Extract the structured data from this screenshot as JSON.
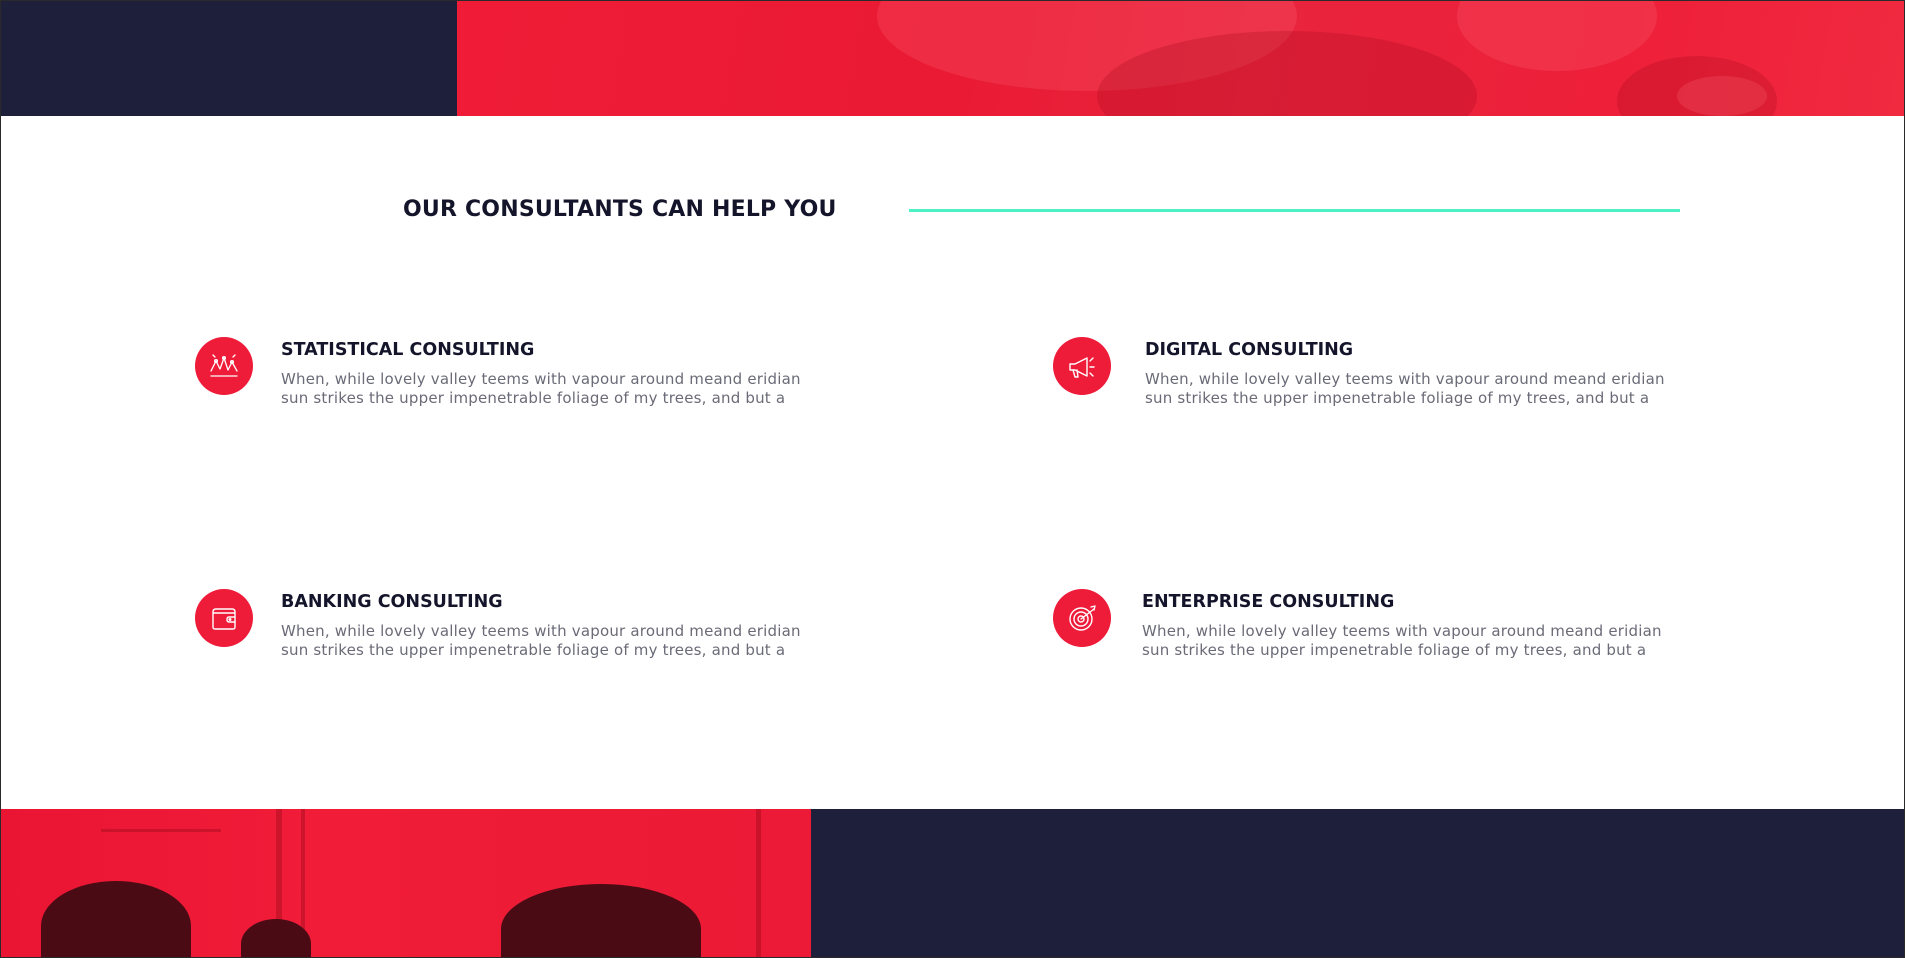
{
  "colors": {
    "navy": "#1e1f3b",
    "accent_red": "#ee1b39",
    "mint_rule": "#4cf2c3",
    "heading_text": "#14152b",
    "body_text": "#6b6b78"
  },
  "section": {
    "title": "OUR CONSULTANTS CAN HELP YOU"
  },
  "services": [
    {
      "icon": "chart-icon",
      "title": "STATISTICAL CONSULTING",
      "description": "When, while lovely valley teems with vapour around meand eridian sun strikes the upper impenetrable foliage of my trees, and but a"
    },
    {
      "icon": "megaphone-icon",
      "title": "DIGITAL CONSULTING",
      "description": "When, while lovely valley teems with vapour around meand eridian sun strikes the upper impenetrable foliage of my trees, and but a"
    },
    {
      "icon": "wallet-icon",
      "title": "BANKING CONSULTING",
      "description": "When, while lovely valley teems with vapour around meand eridian sun strikes the upper impenetrable foliage of my trees, and but a"
    },
    {
      "icon": "target-icon",
      "title": "ENTERPRISE CONSULTING",
      "description": "When, while lovely valley teems with vapour around meand eridian sun strikes the upper impenetrable foliage of my trees, and but a"
    }
  ]
}
